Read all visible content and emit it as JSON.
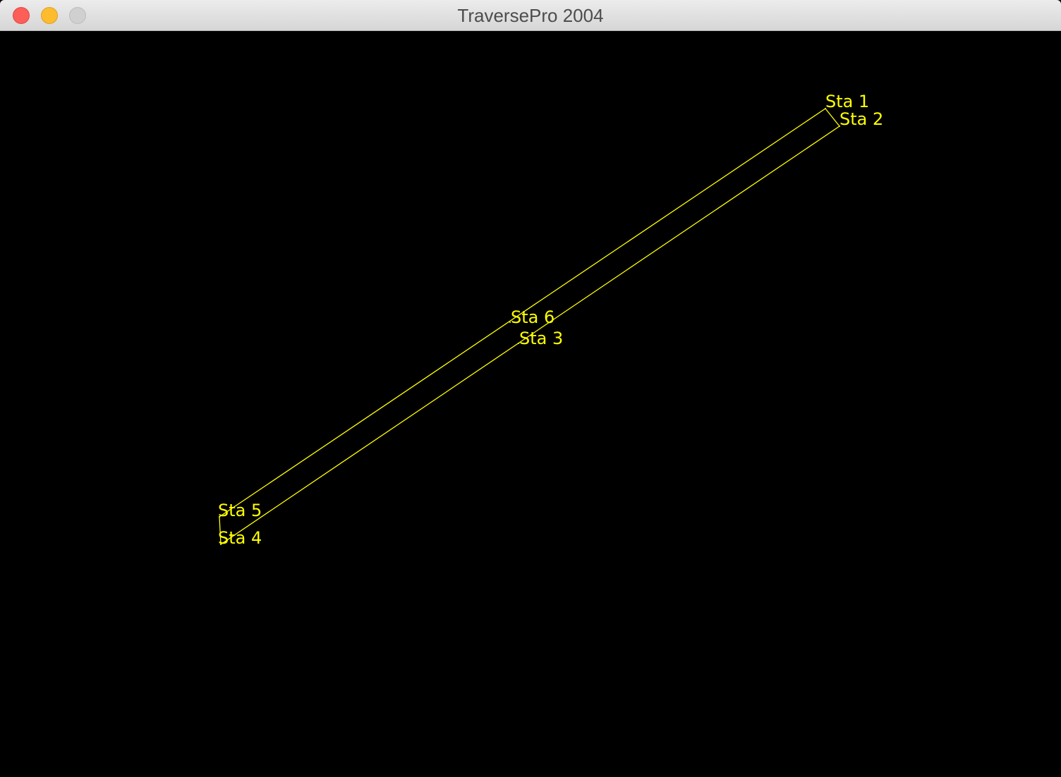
{
  "window": {
    "title": "TraversePro 2004"
  },
  "plot": {
    "background_color": "#000000",
    "line_color": "#ffff00",
    "stations": [
      {
        "label": "Sta 1"
      },
      {
        "label": "Sta 2"
      },
      {
        "label": "Sta 3"
      },
      {
        "label": "Sta 4"
      },
      {
        "label": "Sta 5"
      },
      {
        "label": "Sta 6"
      }
    ]
  }
}
